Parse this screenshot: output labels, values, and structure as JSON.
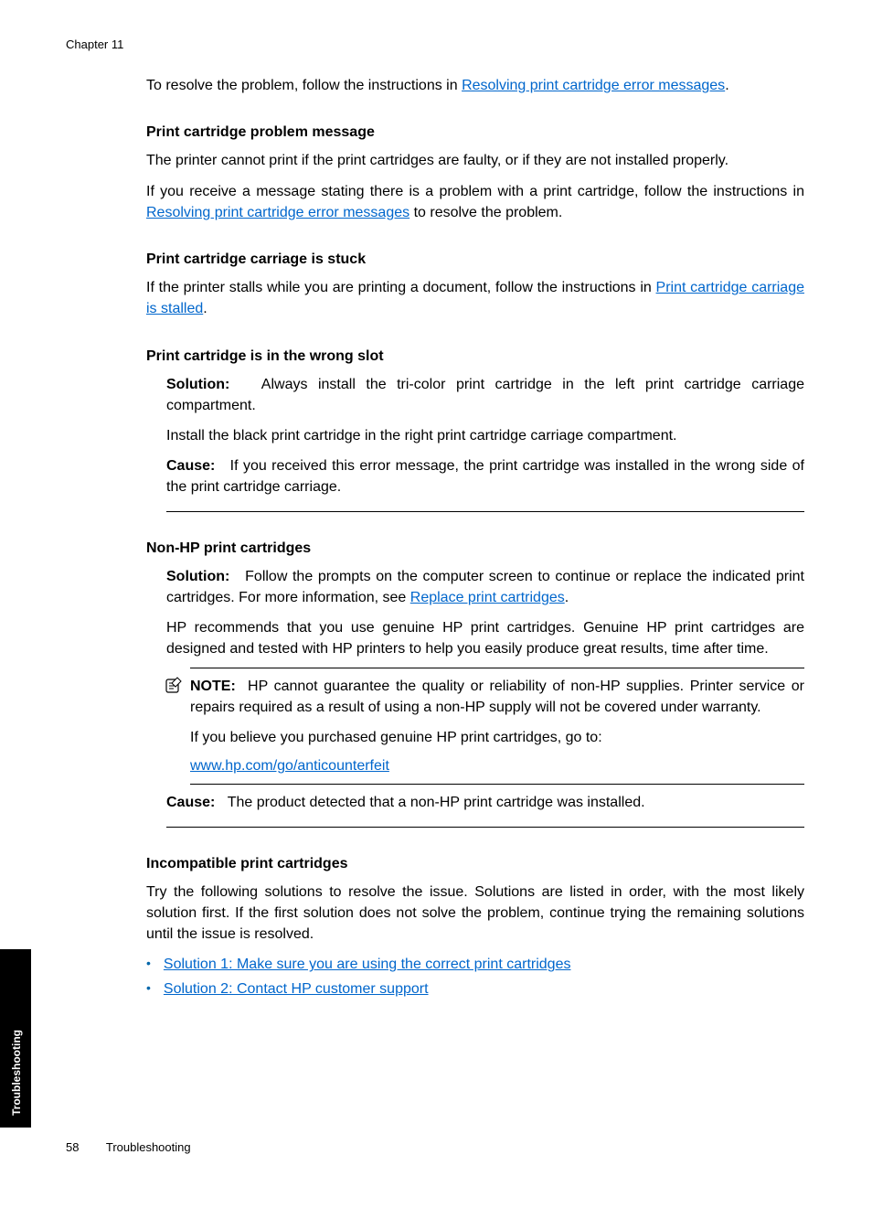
{
  "chapter": "Chapter 11",
  "intro": {
    "pre": "To resolve the problem, follow the instructions in ",
    "link": "Resolving print cartridge error messages",
    "post": "."
  },
  "section1": {
    "heading": "Print cartridge problem message",
    "p1": "The printer cannot print if the print cartridges are faulty, or if they are not installed properly.",
    "p2_pre": "If you receive a message stating there is a problem with a print cartridge, follow the instructions in ",
    "p2_link": "Resolving print cartridge error messages",
    "p2_post": " to resolve the problem."
  },
  "section2": {
    "heading": "Print cartridge carriage is stuck",
    "p1_pre": "If the printer stalls while you are printing a document, follow the instructions in ",
    "p1_link": "Print cartridge carriage is stalled",
    "p1_post": "."
  },
  "section3": {
    "heading": "Print cartridge is in the wrong slot",
    "solution_label": "Solution:",
    "solution_text": "Always install the tri-color print cartridge in the left print cartridge carriage compartment.",
    "p2": "Install the black print cartridge in the right print cartridge carriage compartment.",
    "cause_label": "Cause:",
    "cause_text": "If you received this error message, the print cartridge was installed in the wrong side of the print cartridge carriage."
  },
  "section4": {
    "heading": "Non-HP print cartridges",
    "solution_label": "Solution:",
    "solution_pre": "Follow the prompts on the computer screen to continue or replace the indicated print cartridges. For more information, see ",
    "solution_link": "Replace print cartridges",
    "solution_post": ".",
    "p2": "HP recommends that you use genuine HP print cartridges. Genuine HP print cartridges are designed and tested with HP printers to help you easily produce great results, time after time.",
    "note_label": "NOTE:",
    "note_text": "HP cannot guarantee the quality or reliability of non-HP supplies. Printer service or repairs required as a result of using a non-HP supply will not be covered under warranty.",
    "note_p2": "If you believe you purchased genuine HP print cartridges, go to:",
    "note_link": "www.hp.com/go/anticounterfeit",
    "cause_label": "Cause:",
    "cause_text": "The product detected that a non-HP print cartridge was installed."
  },
  "section5": {
    "heading": "Incompatible print cartridges",
    "p1": "Try the following solutions to resolve the issue. Solutions are listed in order, with the most likely solution first. If the first solution does not solve the problem, continue trying the remaining solutions until the issue is resolved.",
    "bullet1": "Solution 1: Make sure you are using the correct print cartridges",
    "bullet2": "Solution 2: Contact HP customer support"
  },
  "footer": {
    "page": "58",
    "title": "Troubleshooting"
  },
  "sidetab": "Troubleshooting"
}
